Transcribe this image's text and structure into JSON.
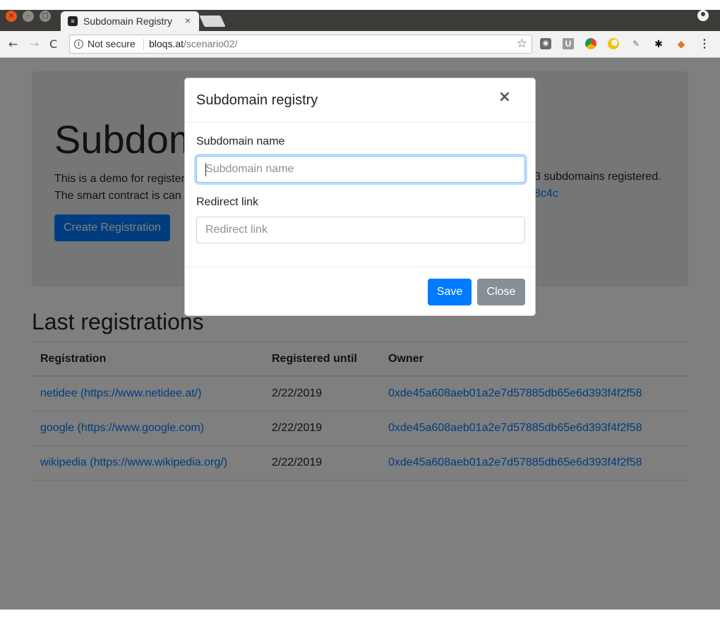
{
  "browser": {
    "tab_title": "Subdomain Registry",
    "tab_close": "×",
    "security_label": "Not secure",
    "url_host": "bloqs.at",
    "url_path": "/scenario02/"
  },
  "page": {
    "hero_title": "Subdomain Registry",
    "hero_line1": "This is a demo for register",
    "hero_line2": "The smart contract is can",
    "hero_count_text": "3 subdomains registered.",
    "hero_contract_fragment": "8c4c",
    "create_button": "Create Registration",
    "section_title": "Last registrations",
    "table": {
      "headers": [
        "Registration",
        "Registered until",
        "Owner"
      ],
      "rows": [
        {
          "registration": "netidee (https://www.netidee.at/)",
          "until": "2/22/2019",
          "owner": "0xde45a608aeb01a2e7d57885db65e6d393f4f2f58"
        },
        {
          "registration": "google (https://www.google.com)",
          "until": "2/22/2019",
          "owner": "0xde45a608aeb01a2e7d57885db65e6d393f4f2f58"
        },
        {
          "registration": "wikipedia (https://www.wikipedia.org/)",
          "until": "2/22/2019",
          "owner": "0xde45a608aeb01a2e7d57885db65e6d393f4f2f58"
        }
      ]
    }
  },
  "modal": {
    "title": "Subdomain registry",
    "close_symbol": "×",
    "subdomain_label": "Subdomain name",
    "subdomain_placeholder": "Subdomain name",
    "redirect_label": "Redirect link",
    "redirect_placeholder": "Redirect link",
    "save_label": "Save",
    "close_label": "Close"
  },
  "colors": {
    "primary": "#007bff",
    "secondary": "#868e96",
    "ubuntu_close": "#e95420"
  }
}
